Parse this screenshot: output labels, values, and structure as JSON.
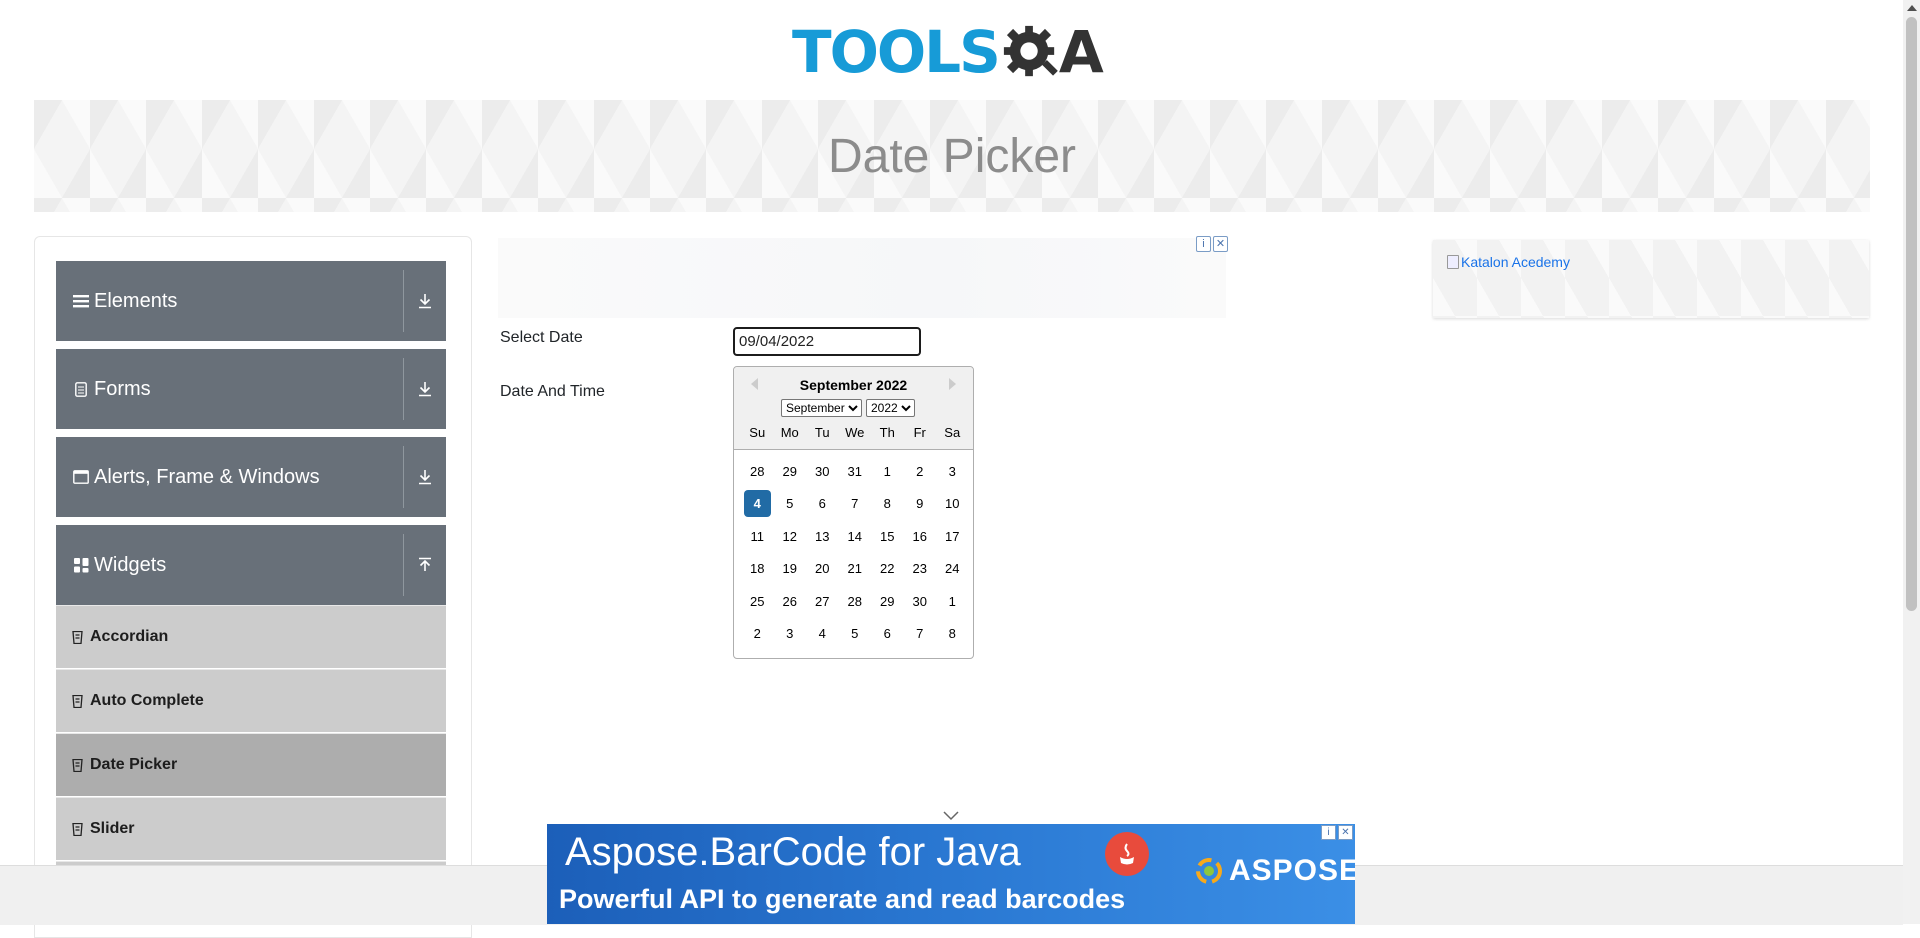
{
  "header": {
    "logo_text_main": "TOOLS",
    "logo_text_suffix": "A"
  },
  "banner": {
    "title": "Date Picker"
  },
  "sidebar": {
    "groups": [
      {
        "label": "Elements",
        "icon": "hamburger-icon",
        "state": "collapsed"
      },
      {
        "label": "Forms",
        "icon": "document-icon",
        "state": "collapsed"
      },
      {
        "label": "Alerts, Frame & Windows",
        "icon": "window-icon",
        "state": "collapsed"
      },
      {
        "label": "Widgets",
        "icon": "grid-icon",
        "state": "expanded"
      }
    ],
    "widgets_items": [
      {
        "label": "Accordian",
        "active": false
      },
      {
        "label": "Auto Complete",
        "active": false
      },
      {
        "label": "Date Picker",
        "active": true
      },
      {
        "label": "Slider",
        "active": false
      }
    ]
  },
  "form": {
    "select_date_label": "Select Date",
    "select_date_value": "09/04/2022",
    "date_time_label": "Date And Time"
  },
  "calendar": {
    "title": "September 2022",
    "month_select": "September",
    "year_select": "2022",
    "weekdays": [
      "Su",
      "Mo",
      "Tu",
      "We",
      "Th",
      "Fr",
      "Sa"
    ],
    "weeks": [
      [
        "28",
        "29",
        "30",
        "31",
        "1",
        "2",
        "3"
      ],
      [
        "4",
        "5",
        "6",
        "7",
        "8",
        "9",
        "10"
      ],
      [
        "11",
        "12",
        "13",
        "14",
        "15",
        "16",
        "17"
      ],
      [
        "18",
        "19",
        "20",
        "21",
        "22",
        "23",
        "24"
      ],
      [
        "25",
        "26",
        "27",
        "28",
        "29",
        "30",
        "1"
      ],
      [
        "2",
        "3",
        "4",
        "5",
        "6",
        "7",
        "8"
      ]
    ],
    "selected_day": "4"
  },
  "ads": {
    "right_alt_text": "Katalon Acedemy",
    "bottom_line1": "Aspose.BarCode for Java",
    "bottom_line2": "Powerful API to generate and read barcodes",
    "bottom_brand": "ASPOSE"
  },
  "colors": {
    "sidebar_group": "#687079",
    "selected_day": "#216ba5",
    "logo_blue": "#179bd7"
  }
}
